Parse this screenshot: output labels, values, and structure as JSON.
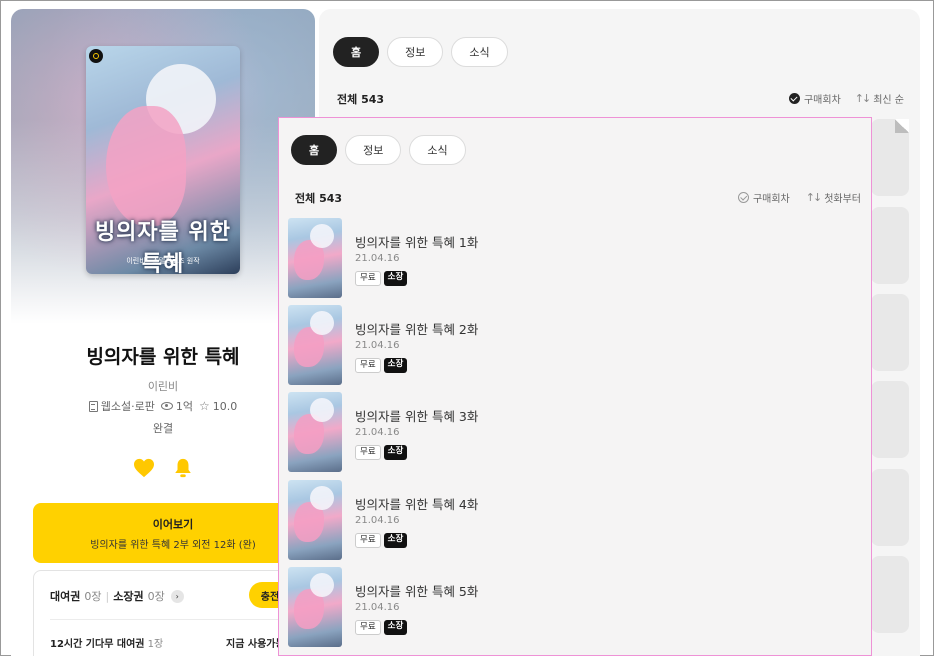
{
  "left_panel": {
    "cover_title": "빙의자를 위한 특혜",
    "cover_credit": "이린비 · 스텔라로즈 원작",
    "title": "빙의자를 위한 특혜",
    "author": "이린비",
    "genre": "웹소설·로판",
    "views": "1억",
    "rating": "10.0",
    "status": "완결",
    "continue_button": {
      "label": "이어보기",
      "subtitle": "빙의자를 위한 특혜 2부 외전 12화 (완)"
    },
    "tickets": {
      "rental_label": "대여권",
      "rental_count": "0장",
      "own_label": "소장권",
      "own_count": "0장",
      "charge_label": "충전",
      "wait_free_label": "12시간 기다무 대여권",
      "wait_free_count": "1장",
      "available_now": "지금 사용가능"
    },
    "colors": {
      "accent": "#ffd100"
    }
  },
  "background_panel": {
    "tabs": [
      {
        "label": "홈",
        "active": true
      },
      {
        "label": "정보",
        "active": false
      },
      {
        "label": "소식",
        "active": false
      }
    ],
    "total_label": "전체 543",
    "purchased_label": "구매회차",
    "sort_label": "최신 순"
  },
  "overlay_panel": {
    "tabs": [
      {
        "label": "홈",
        "active": true
      },
      {
        "label": "정보",
        "active": false
      },
      {
        "label": "소식",
        "active": false
      }
    ],
    "total_label": "전체 543",
    "purchased_label": "구매회차",
    "sort_label": "첫화부터",
    "badge_free": "무료",
    "badge_own": "소장",
    "episodes": [
      {
        "title": "빙의자를 위한 특혜 1화",
        "date": "21.04.16"
      },
      {
        "title": "빙의자를 위한 특혜 2화",
        "date": "21.04.16"
      },
      {
        "title": "빙의자를 위한 특혜 3화",
        "date": "21.04.16"
      },
      {
        "title": "빙의자를 위한 특혜 4화",
        "date": "21.04.16"
      },
      {
        "title": "빙의자를 위한 특혜 5화",
        "date": "21.04.16"
      }
    ],
    "colors": {
      "highlight_border": "#ee92d6"
    }
  }
}
